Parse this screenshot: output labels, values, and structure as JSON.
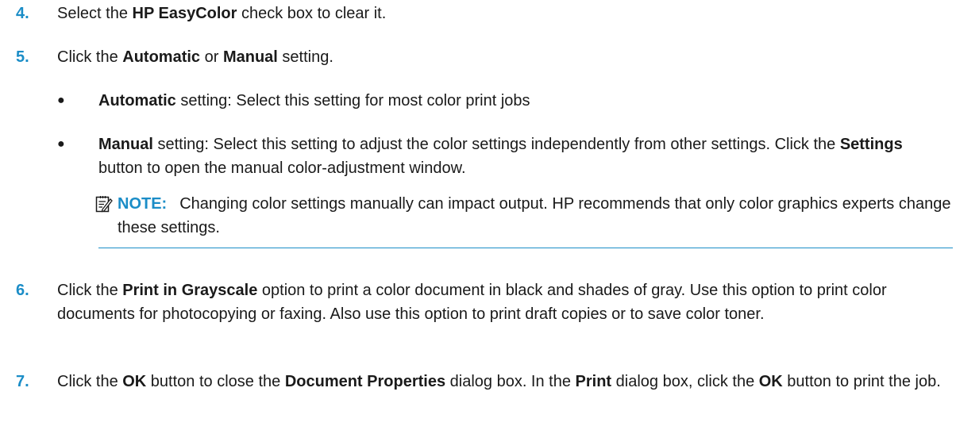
{
  "steps": [
    {
      "num": "4.",
      "parts": [
        "Select the ",
        "HP EasyColor",
        " check box to clear it."
      ]
    },
    {
      "num": "5.",
      "parts": [
        "Click the ",
        "Automatic",
        " or ",
        "Manual",
        " setting."
      ]
    },
    {
      "num": "6.",
      "parts": [
        "Click the ",
        "Print in Grayscale",
        " option to print a color document in black and shades of gray. Use this option to print color documents for photocopying or faxing. Also use this option to print draft copies or to save color toner."
      ]
    },
    {
      "num": "7.",
      "parts": [
        "Click the ",
        "OK",
        " button to close the ",
        "Document Properties",
        " dialog box. In the ",
        "Print",
        " dialog box, click the ",
        "OK",
        " button to print the job."
      ]
    }
  ],
  "bullets": [
    {
      "mark": "●",
      "parts": [
        "Automatic",
        " setting: Select this setting for most color print jobs"
      ]
    },
    {
      "mark": "●",
      "parts": [
        "Manual",
        " setting: Select this setting to adjust the color settings independently from other settings. Click the ",
        "Settings",
        " button to open the manual color-adjustment window."
      ]
    }
  ],
  "note": {
    "label": "NOTE:",
    "text": "Changing color settings manually can impact output. HP recommends that only color graphics experts change these settings.",
    "icon": "note-icon"
  },
  "colors": {
    "accent": "#1b8dc7",
    "text": "#1a1a1a"
  }
}
